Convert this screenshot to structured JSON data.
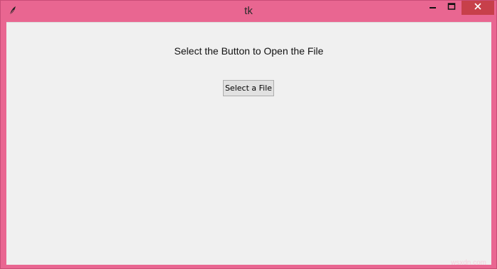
{
  "window": {
    "title": "tk",
    "icon": "feather-icon",
    "controls": {
      "minimize_icon": "minimize-icon",
      "maximize_icon": "maximize-icon",
      "close_icon": "close-icon"
    },
    "colors": {
      "frame": "#e96691",
      "close_button": "#c7404a",
      "client_background": "#f0f0f0"
    }
  },
  "main": {
    "prompt": "Select the Button to Open the File",
    "button_label": "Select a File"
  },
  "watermark": "wsxdn.com"
}
